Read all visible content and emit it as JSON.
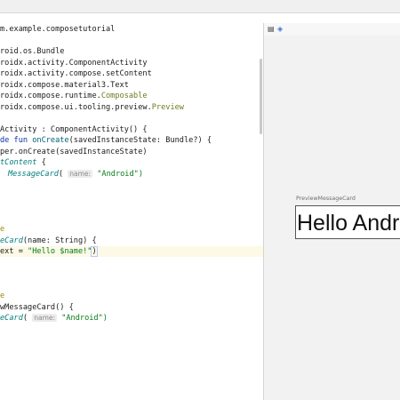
{
  "editor": {
    "lines": {
      "l1": "m.example.composetutorial",
      "l2": "roid.os.Bundle",
      "l3": "roidx.activity.ComponentActivity",
      "l4": "roidx.activity.compose.setContent",
      "l5": "roidx.compose.material3.Text",
      "l6a": "roidx.compose.runtime.",
      "l6b": "Composable",
      "l7a": "roidx.compose.ui.tooling.preview.",
      "l7b": "Preview",
      "l8": "Activity : ComponentActivity() {",
      "l9a": "de fun ",
      "l9b": "onCreate",
      "l9c": "(savedInstanceState: Bundle?) {",
      "l10": "per.onCreate(savedInstanceState)",
      "l11a": "tContent",
      "l11b": " {",
      "l12a": "MessageCard",
      "l12b": "( ",
      "l12hint": "name:",
      "l12c": " \"Android\")",
      "l13": "e",
      "l14a": "eCard",
      "l14b": "(name: String) {",
      "l15a": "ext = ",
      "l15b": "\"Hello $name!\"",
      "l15c": ")",
      "l16": "e",
      "l17": "wMessageCard() {",
      "l18a": "eCard",
      "l18b": "( ",
      "l18hint": "name:",
      "l18c": " \"Android\")"
    }
  },
  "preview": {
    "label": "PreviewMessageCard",
    "text": "Hello Android"
  },
  "toolbar": {
    "icon1": "▤",
    "icon2": "◈"
  }
}
